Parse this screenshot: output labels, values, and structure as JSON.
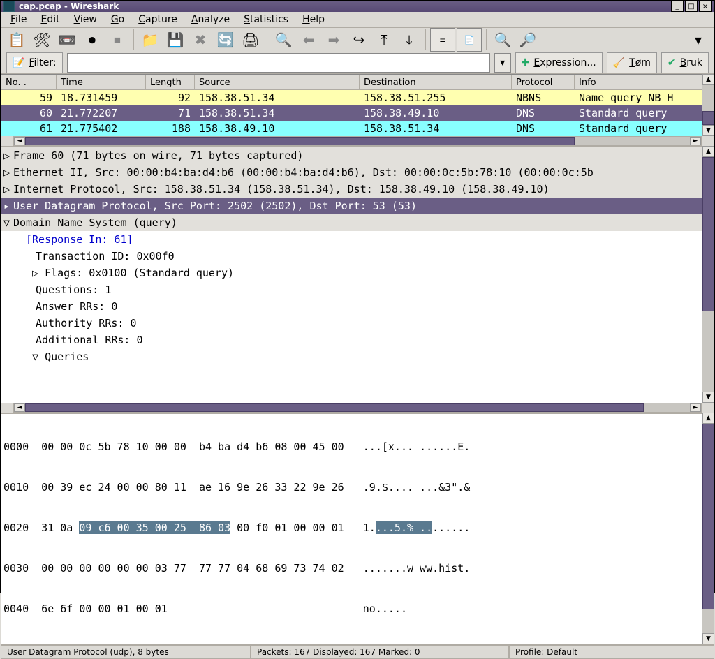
{
  "window": {
    "title": "cap.pcap - Wireshark"
  },
  "menu": {
    "file": "File",
    "edit": "Edit",
    "view": "View",
    "go": "Go",
    "capture": "Capture",
    "analyze": "Analyze",
    "statistics": "Statistics",
    "help": "Help"
  },
  "filter": {
    "label": "Filter:",
    "value": "",
    "expression": "Expression...",
    "tom": "Tøm",
    "bruk": "Bruk"
  },
  "columns": {
    "no": "No. .",
    "time": "Time",
    "length": "Length",
    "source": "Source",
    "destination": "Destination",
    "protocol": "Protocol",
    "info": "Info"
  },
  "packets": [
    {
      "no": "59",
      "time": "18.731459",
      "len": "92",
      "src": "158.38.51.34",
      "dst": "158.38.51.255",
      "proto": "NBNS",
      "info": "Name query NB H",
      "cls": "yellow"
    },
    {
      "no": "60",
      "time": "21.772207",
      "len": "71",
      "src": "158.38.51.34",
      "dst": "158.38.49.10",
      "proto": "DNS",
      "info": "Standard query ",
      "cls": "purple"
    },
    {
      "no": "61",
      "time": "21.775402",
      "len": "188",
      "src": "158.38.49.10",
      "dst": "158.38.51.34",
      "proto": "DNS",
      "info": "Standard query ",
      "cls": "cyan"
    }
  ],
  "details": {
    "frame": "Frame 60 (71 bytes on wire, 71 bytes captured)",
    "eth": "Ethernet II, Src: 00:00:b4:ba:d4:b6 (00:00:b4:ba:d4:b6), Dst: 00:00:0c:5b:78:10 (00:00:0c:5b",
    "ip": "Internet Protocol, Src: 158.38.51.34 (158.38.51.34), Dst: 158.38.49.10 (158.38.49.10)",
    "udp": "User Datagram Protocol, Src Port: 2502 (2502), Dst Port: 53 (53)",
    "dns_header": "Domain Name System (query)",
    "response_in": "[Response In: 61]",
    "txid": "Transaction ID: 0x00f0",
    "flags": "Flags: 0x0100 (Standard query)",
    "questions": "Questions: 1",
    "answer_rrs": "Answer RRs: 0",
    "authority_rrs": "Authority RRs: 0",
    "additional_rrs": "Additional RRs: 0",
    "queries": "Queries"
  },
  "hex": {
    "l0_off": "0000",
    "l0_hex": "  00 00 0c 5b 78 10 00 00  b4 ba d4 b6 08 00 45 00   ",
    "l0_asc": "...[x... ......E.",
    "l1_off": "0010",
    "l1_hex": "  00 39 ec 24 00 00 80 11  ae 16 9e 26 33 22 9e 26   ",
    "l1_asc": ".9.$.... ...&3\".&",
    "l2_off": "0020",
    "l2_pre": "  31 0a ",
    "l2_hl": "09 c6 00 35 00 25  86 03",
    "l2_post": " 00 f0 01 00 00 01   ",
    "l2_asc_pre": "1.",
    "l2_asc_hl": "...5.% ..",
    "l2_asc_post": "......",
    "l3_off": "0030",
    "l3_hex": "  00 00 00 00 00 00 03 77  77 77 04 68 69 73 74 02   ",
    "l3_asc": ".......w ww.hist.",
    "l4_off": "0040",
    "l4_hex": "  6e 6f 00 00 01 00 01                               ",
    "l4_asc": "no....."
  },
  "status": {
    "left": "User Datagram Protocol (udp), 8 bytes",
    "mid": "Packets: 167 Displayed: 167 Marked: 0",
    "right": "Profile: Default"
  }
}
